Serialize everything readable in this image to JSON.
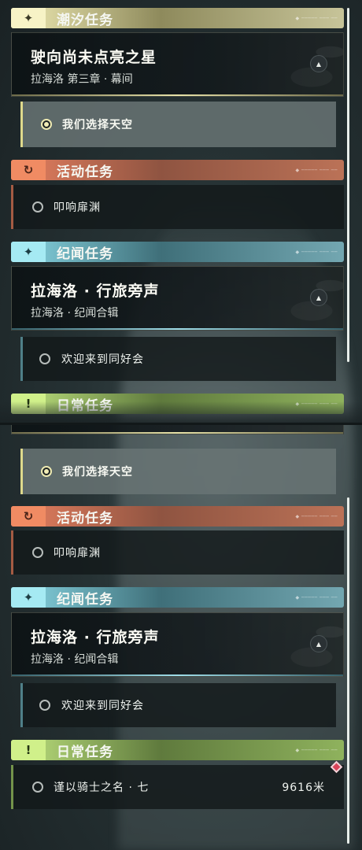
{
  "colors": {
    "tide": "#f1ecb5",
    "event": "#e78060",
    "lore": "#8ad9e6",
    "daily": "#c0e480",
    "tracked_pin": "#d9455a"
  },
  "icons": {
    "tide": "sparkle-icon",
    "event": "refresh-icon",
    "lore": "sparkle-icon",
    "daily": "exclamation-box-icon",
    "collapse": "chevron-up-icon",
    "radio": "radio-icon",
    "pin": "tracked-marker-icon"
  },
  "header_glyphs": {
    "sparkle": "✦",
    "refresh": "↻",
    "exclamation": "!"
  },
  "collapse_glyph": "▲",
  "sections": {
    "tide": {
      "title": "潮汐任务"
    },
    "event": {
      "title": "活动任务"
    },
    "lore": {
      "title": "纪闻任务"
    },
    "daily": {
      "title": "日常任务"
    }
  },
  "tide_card": {
    "name": "驶向尚未点亮之星",
    "subtitle": "拉海洛 第三章 · 幕间"
  },
  "tide_task": {
    "label": "我们选择天空",
    "selected": true
  },
  "event_task": {
    "label": "叩响扉渊",
    "selected": false
  },
  "lore_card": {
    "name": "拉海洛 · 行旅旁声",
    "subtitle": "拉海洛 · 纪闻合辑"
  },
  "lore_task": {
    "label": "欢迎来到同好会",
    "selected": false
  },
  "daily_task": {
    "label": "谨以骑士之名 · 七",
    "distance": "9616米",
    "selected": false
  }
}
